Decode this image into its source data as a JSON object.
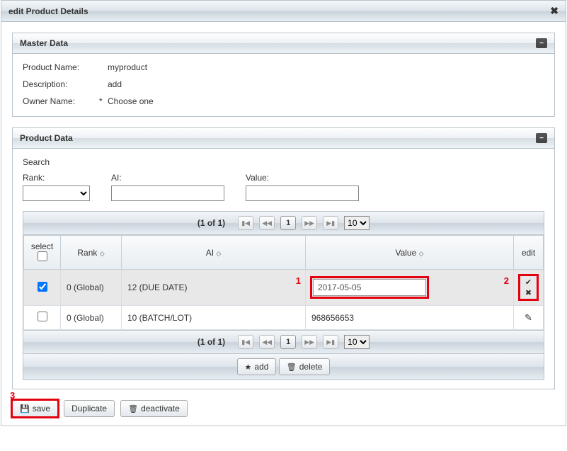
{
  "dialog": {
    "title": "edit Product Details"
  },
  "panels": {
    "master": {
      "title": "Master Data",
      "fields": {
        "product_name_label": "Product Name:",
        "product_name_value": "myproduct",
        "description_label": "Description:",
        "description_value": "add",
        "owner_name_label": "Owner Name:",
        "owner_name_req": "*",
        "owner_name_value": "Choose one"
      }
    },
    "product": {
      "title": "Product Data",
      "search": {
        "label": "Search",
        "rank_label": "Rank:",
        "ai_label": "AI:",
        "value_label": "Value:"
      }
    }
  },
  "paginator": {
    "info": "(1 of 1)",
    "current": "1",
    "page_size": "10"
  },
  "table": {
    "headers": {
      "select": "select",
      "rank": "Rank",
      "ai": "AI",
      "value": "Value",
      "edit": "edit"
    },
    "rows": [
      {
        "selected": true,
        "rank": "0 (Global)",
        "ai": "12 (DUE DATE)",
        "value": "2017-05-05",
        "editing": true
      },
      {
        "selected": false,
        "rank": "0 (Global)",
        "ai": "10 (BATCH/LOT)",
        "value": "968656653",
        "editing": false
      }
    ]
  },
  "buttons": {
    "add": "add",
    "delete": "delete",
    "save": "save",
    "duplicate": "Duplicate",
    "deactivate": "deactivate"
  },
  "annotations": {
    "n1": "1",
    "n2": "2",
    "n3": "3"
  }
}
